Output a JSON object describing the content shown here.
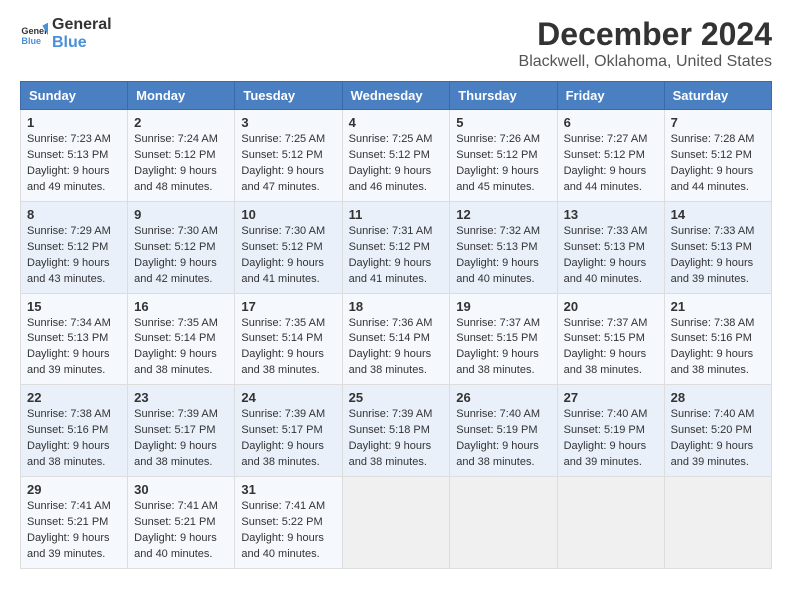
{
  "header": {
    "logo_general": "General",
    "logo_blue": "Blue",
    "main_title": "December 2024",
    "subtitle": "Blackwell, Oklahoma, United States"
  },
  "calendar": {
    "days_of_week": [
      "Sunday",
      "Monday",
      "Tuesday",
      "Wednesday",
      "Thursday",
      "Friday",
      "Saturday"
    ],
    "weeks": [
      [
        {
          "day": "1",
          "sunrise": "7:23 AM",
          "sunset": "5:13 PM",
          "daylight": "9 hours and 49 minutes."
        },
        {
          "day": "2",
          "sunrise": "7:24 AM",
          "sunset": "5:12 PM",
          "daylight": "9 hours and 48 minutes."
        },
        {
          "day": "3",
          "sunrise": "7:25 AM",
          "sunset": "5:12 PM",
          "daylight": "9 hours and 47 minutes."
        },
        {
          "day": "4",
          "sunrise": "7:25 AM",
          "sunset": "5:12 PM",
          "daylight": "9 hours and 46 minutes."
        },
        {
          "day": "5",
          "sunrise": "7:26 AM",
          "sunset": "5:12 PM",
          "daylight": "9 hours and 45 minutes."
        },
        {
          "day": "6",
          "sunrise": "7:27 AM",
          "sunset": "5:12 PM",
          "daylight": "9 hours and 44 minutes."
        },
        {
          "day": "7",
          "sunrise": "7:28 AM",
          "sunset": "5:12 PM",
          "daylight": "9 hours and 44 minutes."
        }
      ],
      [
        {
          "day": "8",
          "sunrise": "7:29 AM",
          "sunset": "5:12 PM",
          "daylight": "9 hours and 43 minutes."
        },
        {
          "day": "9",
          "sunrise": "7:30 AM",
          "sunset": "5:12 PM",
          "daylight": "9 hours and 42 minutes."
        },
        {
          "day": "10",
          "sunrise": "7:30 AM",
          "sunset": "5:12 PM",
          "daylight": "9 hours and 41 minutes."
        },
        {
          "day": "11",
          "sunrise": "7:31 AM",
          "sunset": "5:12 PM",
          "daylight": "9 hours and 41 minutes."
        },
        {
          "day": "12",
          "sunrise": "7:32 AM",
          "sunset": "5:13 PM",
          "daylight": "9 hours and 40 minutes."
        },
        {
          "day": "13",
          "sunrise": "7:33 AM",
          "sunset": "5:13 PM",
          "daylight": "9 hours and 40 minutes."
        },
        {
          "day": "14",
          "sunrise": "7:33 AM",
          "sunset": "5:13 PM",
          "daylight": "9 hours and 39 minutes."
        }
      ],
      [
        {
          "day": "15",
          "sunrise": "7:34 AM",
          "sunset": "5:13 PM",
          "daylight": "9 hours and 39 minutes."
        },
        {
          "day": "16",
          "sunrise": "7:35 AM",
          "sunset": "5:14 PM",
          "daylight": "9 hours and 38 minutes."
        },
        {
          "day": "17",
          "sunrise": "7:35 AM",
          "sunset": "5:14 PM",
          "daylight": "9 hours and 38 minutes."
        },
        {
          "day": "18",
          "sunrise": "7:36 AM",
          "sunset": "5:14 PM",
          "daylight": "9 hours and 38 minutes."
        },
        {
          "day": "19",
          "sunrise": "7:37 AM",
          "sunset": "5:15 PM",
          "daylight": "9 hours and 38 minutes."
        },
        {
          "day": "20",
          "sunrise": "7:37 AM",
          "sunset": "5:15 PM",
          "daylight": "9 hours and 38 minutes."
        },
        {
          "day": "21",
          "sunrise": "7:38 AM",
          "sunset": "5:16 PM",
          "daylight": "9 hours and 38 minutes."
        }
      ],
      [
        {
          "day": "22",
          "sunrise": "7:38 AM",
          "sunset": "5:16 PM",
          "daylight": "9 hours and 38 minutes."
        },
        {
          "day": "23",
          "sunrise": "7:39 AM",
          "sunset": "5:17 PM",
          "daylight": "9 hours and 38 minutes."
        },
        {
          "day": "24",
          "sunrise": "7:39 AM",
          "sunset": "5:17 PM",
          "daylight": "9 hours and 38 minutes."
        },
        {
          "day": "25",
          "sunrise": "7:39 AM",
          "sunset": "5:18 PM",
          "daylight": "9 hours and 38 minutes."
        },
        {
          "day": "26",
          "sunrise": "7:40 AM",
          "sunset": "5:19 PM",
          "daylight": "9 hours and 38 minutes."
        },
        {
          "day": "27",
          "sunrise": "7:40 AM",
          "sunset": "5:19 PM",
          "daylight": "9 hours and 39 minutes."
        },
        {
          "day": "28",
          "sunrise": "7:40 AM",
          "sunset": "5:20 PM",
          "daylight": "9 hours and 39 minutes."
        }
      ],
      [
        {
          "day": "29",
          "sunrise": "7:41 AM",
          "sunset": "5:21 PM",
          "daylight": "9 hours and 39 minutes."
        },
        {
          "day": "30",
          "sunrise": "7:41 AM",
          "sunset": "5:21 PM",
          "daylight": "9 hours and 40 minutes."
        },
        {
          "day": "31",
          "sunrise": "7:41 AM",
          "sunset": "5:22 PM",
          "daylight": "9 hours and 40 minutes."
        },
        null,
        null,
        null,
        null
      ]
    ]
  }
}
